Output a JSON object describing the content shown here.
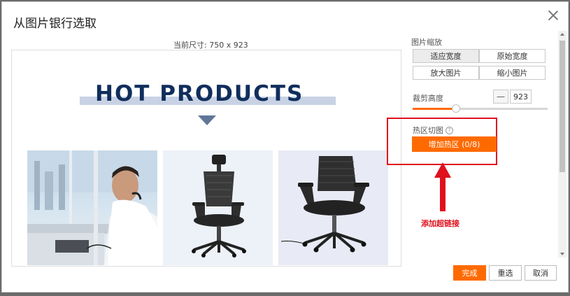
{
  "dialog": {
    "title": "从图片银行选取",
    "size_label": "当前尺寸: 750 x 923"
  },
  "banner": {
    "text": "HOT PRODUCTS"
  },
  "zoom": {
    "label": "图片缩放",
    "fit_width": "适应宽度",
    "original_width": "原始宽度",
    "zoom_in": "放大图片",
    "zoom_out": "缩小图片"
  },
  "crop": {
    "label": "裁剪高度",
    "minus": "—",
    "value": "923",
    "slider_percent": 32
  },
  "hotspot": {
    "label": "热区切图",
    "help": "?",
    "add_button": "增加热区 (0/8)"
  },
  "annotation": {
    "text": "添加超链接"
  },
  "footer": {
    "done": "完成",
    "reselect": "重选",
    "cancel": "取消"
  },
  "colors": {
    "accent": "#ff6a00",
    "annotation_red": "#e0111e",
    "banner_navy": "#102e5c"
  }
}
